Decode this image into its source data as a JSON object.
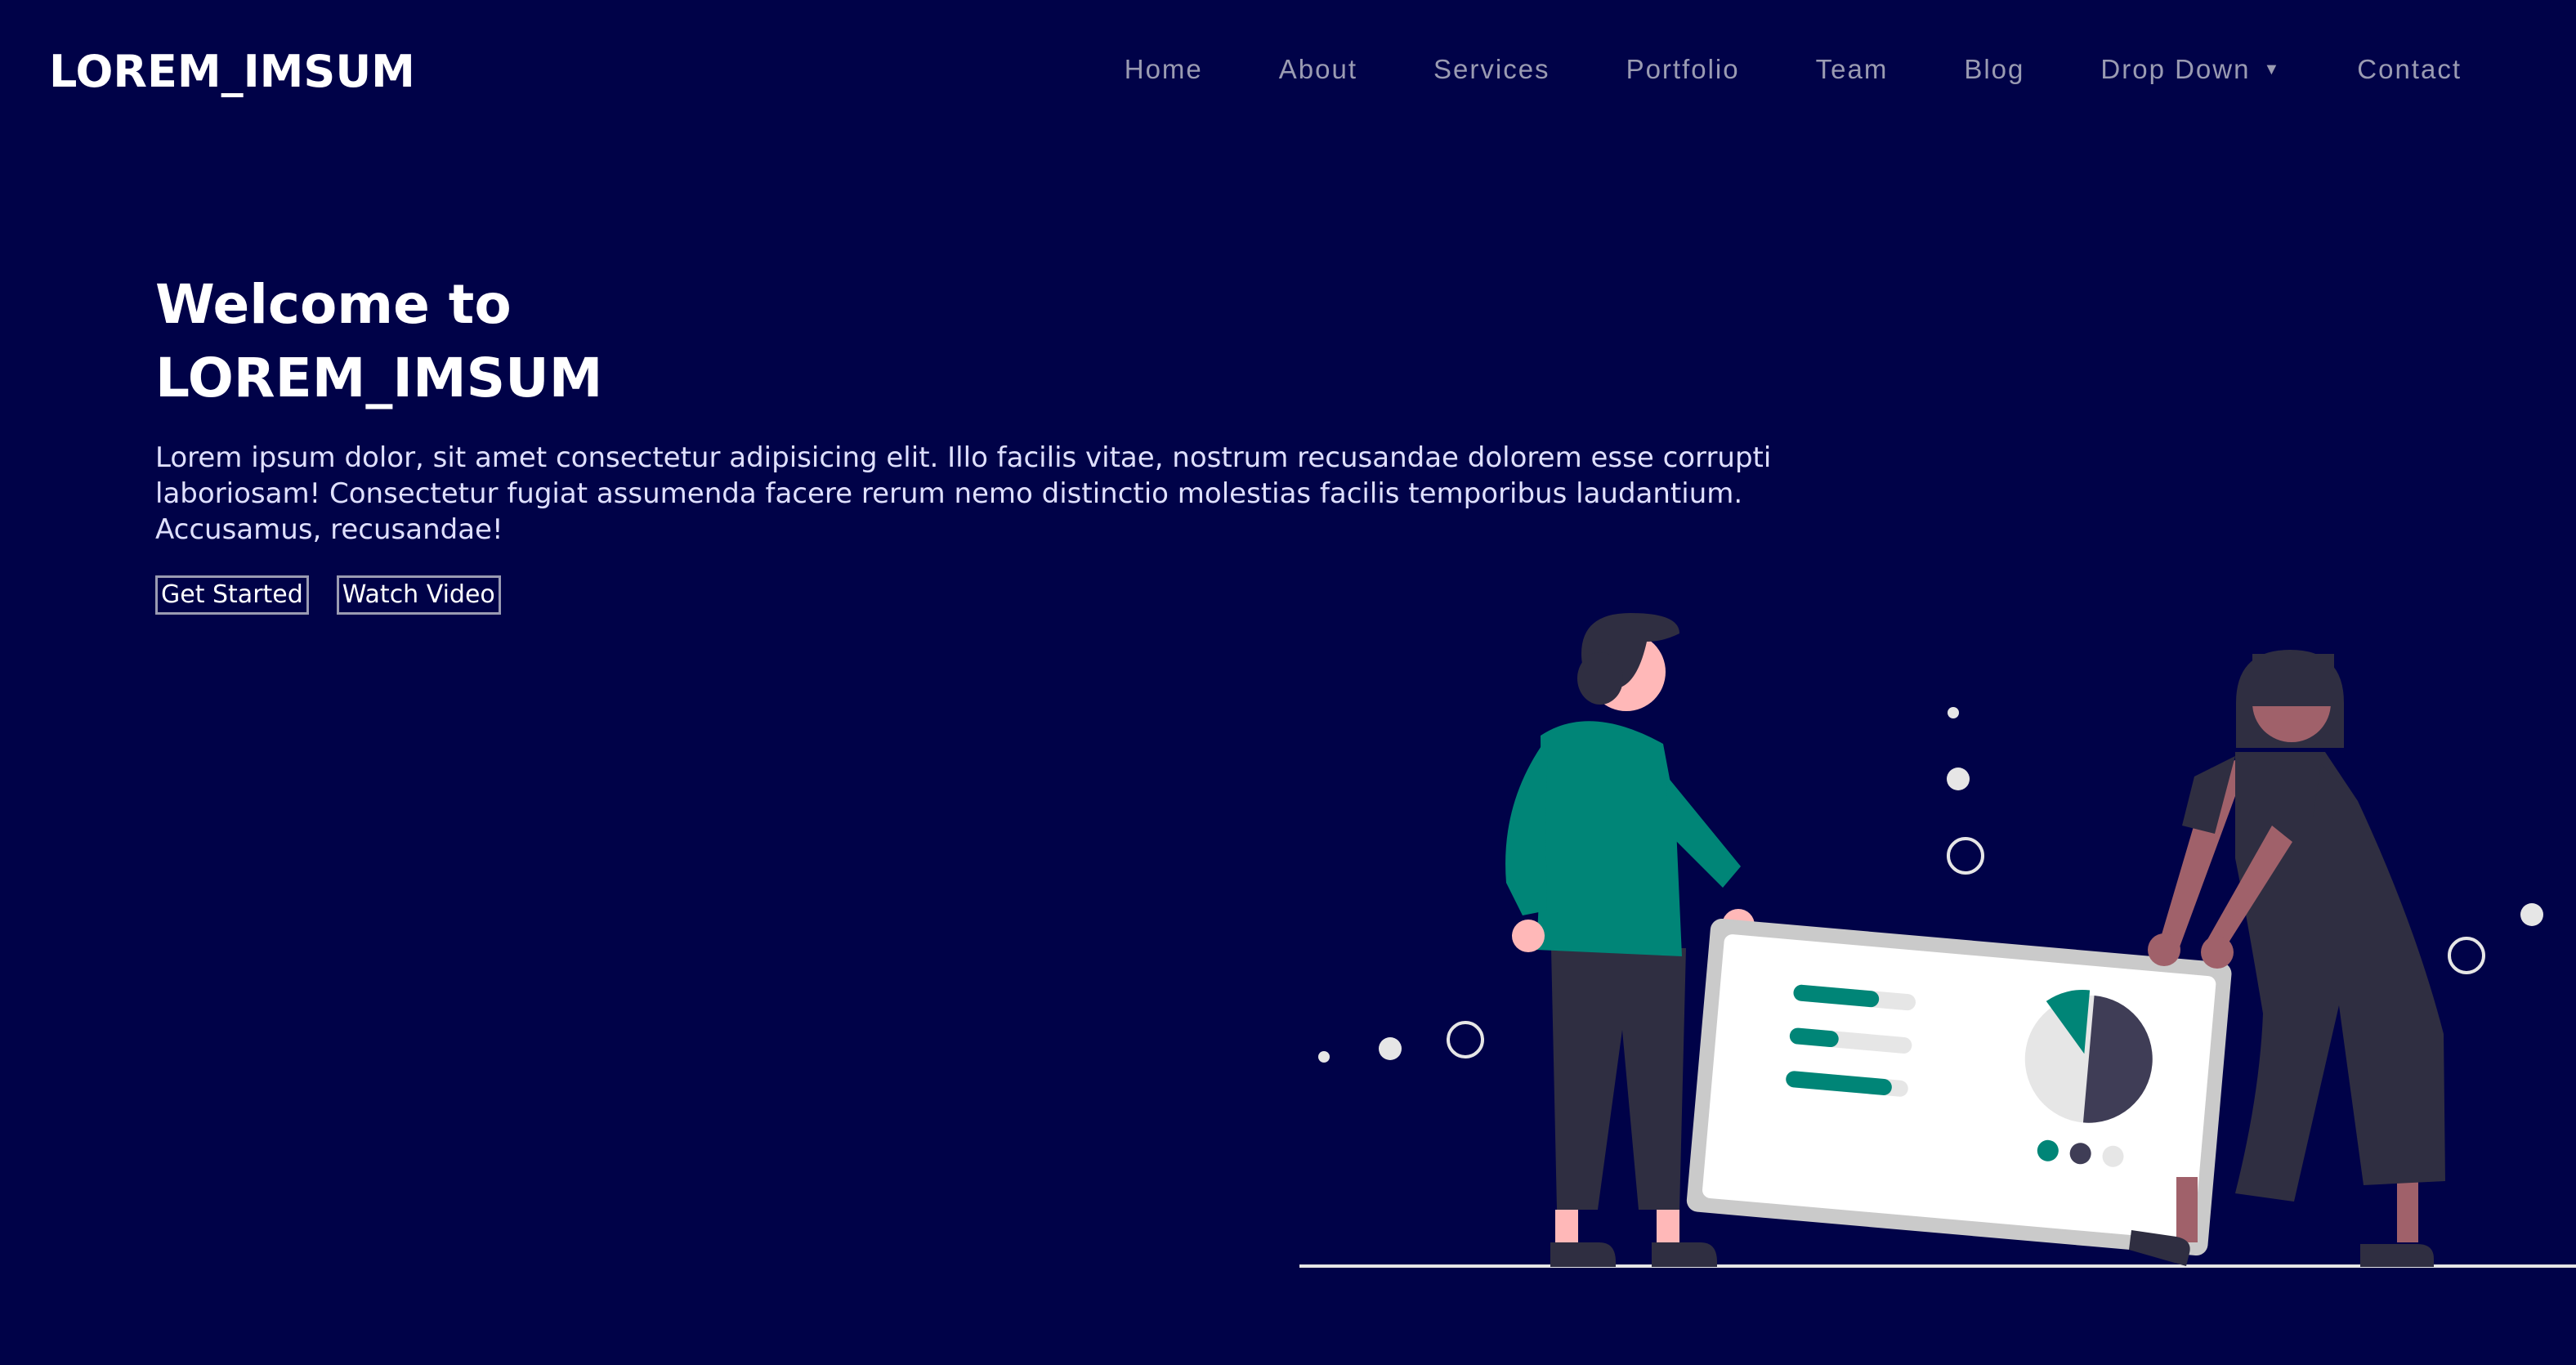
{
  "header": {
    "logo": "LOREM_IMSUM",
    "nav": [
      {
        "label": "Home"
      },
      {
        "label": "About"
      },
      {
        "label": "Services"
      },
      {
        "label": "Portfolio"
      },
      {
        "label": "Team"
      },
      {
        "label": "Blog"
      },
      {
        "label": "Drop Down",
        "caret": "▼"
      },
      {
        "label": "Contact"
      }
    ]
  },
  "hero": {
    "title_line1": "Welcome to",
    "title_line2": "LOREM_IMSUM",
    "description": "Lorem ipsum dolor, sit amet consectetur adipisicing elit. Illo facilis vitae, nostrum recusandae dolorem esse corrupti laboriosam! Consectetur fugiat assumenda facere rerum nemo distinctio molestias facilis temporibus laudantium. Accusamus, recusandae!",
    "primary_button": "Get Started",
    "secondary_button": "Watch Video"
  },
  "colors": {
    "background": "#000248",
    "accent": "#008577",
    "nav_text": "#9a9bb2",
    "figure_dark": "#2f2e41",
    "skin_light": "#ffb8b8",
    "skin_dark": "#a0616a"
  },
  "illustration": {
    "name": "two-people-holding-dashboard-board"
  }
}
